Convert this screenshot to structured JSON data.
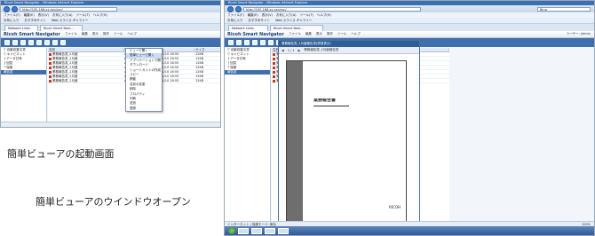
{
  "screen1": {
    "window_title": "Ricoh Smart Navigator - Windows Internet Explorer",
    "address": "http://192.168.xx.xxx/rsn/",
    "ie_menu": [
      "ファイル(F)",
      "編集(E)",
      "表示(V)",
      "お気に入り(A)",
      "ツール(T)",
      "ヘルプ(H)"
    ],
    "favorites": [
      "お気に入り",
      "おすすめサイト",
      "Web スライス ギャラリー"
    ],
    "tabs": [
      "Network Links",
      "Ricoh Smart Navi..."
    ],
    "app_title": "Ricoh Smart Navigator",
    "app_menu": [
      "ファイル",
      "編集",
      "表示",
      "操作",
      "ツール",
      "ヘルプ"
    ],
    "sidebar": [
      {
        "label": "▽ 自動収集文書",
        "selected": false
      },
      {
        "label": "▽ キャビネット",
        "selected": false
      },
      {
        "label": "  ├ データ共有",
        "selected": false
      },
      {
        "label": "  ├ 回覧",
        "selected": false
      },
      {
        "label": "  └ 保管",
        "selected": false
      },
      {
        "label": "報告書",
        "selected": true
      }
    ],
    "grid_headers": [
      "名前",
      "更新者",
      "更新日時",
      "サイズ"
    ],
    "rows": [
      [
        "業務報告書_2月度",
        "Admin",
        "2014/01/10 18:55",
        "12KB"
      ],
      [
        "業務報告書_2月度",
        "Admin",
        "2014/01/10 18:55",
        "12KB"
      ],
      [
        "業務報告書_2月度",
        "Admin",
        "2014/01/10 18:55",
        "12KB"
      ],
      [
        "業務報告書_2月度",
        "Admin",
        "2014/01/10 18:55",
        "12KB"
      ],
      [
        "業務報告書_2月度",
        "Admin",
        "2014/01/10 18:55",
        "12KB"
      ],
      [
        "業務報告書_2月度",
        "Admin",
        "2014/01/10 18:55",
        "12KB"
      ],
      [
        "業務報告書_2月度",
        "Admin",
        "2014/01/10 18:55",
        "12KB"
      ]
    ],
    "context_menu": [
      "ビューで開く",
      "簡単ビューで開く",
      "アプリケーションで開く",
      "ダウンロード",
      "ショートカットの作成",
      "コピー",
      "移動",
      "名前の変更",
      "削除",
      "プロパティ",
      "印刷",
      "送信",
      "登録"
    ]
  },
  "caption1": "簡単ビューアの起動画面",
  "caption2": "簡単ビューアのウインドウオープン",
  "screen2": {
    "window_title": "Ricoh Smart Navigator - Windows Internet Explorer",
    "address": "http://192.168.xx.xxx/rsn/",
    "search_placeholder": "Bing",
    "ie_menu": [
      "ファイル(F)",
      "編集(E)",
      "表示(V)",
      "お気に入り(A)",
      "ツール(T)",
      "ヘルプ(H)"
    ],
    "favorites": [
      "お気に入り",
      "おすすめサイト",
      "Web スライス ギャラリー"
    ],
    "tabs": [
      "Network Links",
      "Ricoh Smart Navi..."
    ],
    "app_title": "Ricoh Smart Navigator",
    "app_menu": [
      "ファイル",
      "編集",
      "表示",
      "操作",
      "ツール",
      "ヘルプ"
    ],
    "user": "ユーザー: Admin",
    "viewer_title": "業務報告書_2月度報告書(簡易表示)",
    "viewer_tools": [
      "◀",
      "1 / 1",
      "▶",
      "業務報告書_2月度報告書"
    ],
    "doc_heading": "業務報告書",
    "doc_footer": "RICOH",
    "rows": [
      [
        "2014/01/10",
        "Admin"
      ],
      [
        "2014/01/10",
        "Admin"
      ],
      [
        "2014/01/10",
        "Admin"
      ],
      [
        "2014/01/10",
        "Admin"
      ],
      [
        "2014/01/10",
        "Admin"
      ],
      [
        "2014/01/10",
        "Admin"
      ],
      [
        "2014/01/10",
        "Admin"
      ]
    ],
    "status": "インターネット | 保護モード: 無効",
    "zoom": "100%"
  },
  "colors": {
    "ie_blue": "#3b6fb4",
    "toolbar_blue": "#3f70ad",
    "selection": "#c7ddf7"
  }
}
